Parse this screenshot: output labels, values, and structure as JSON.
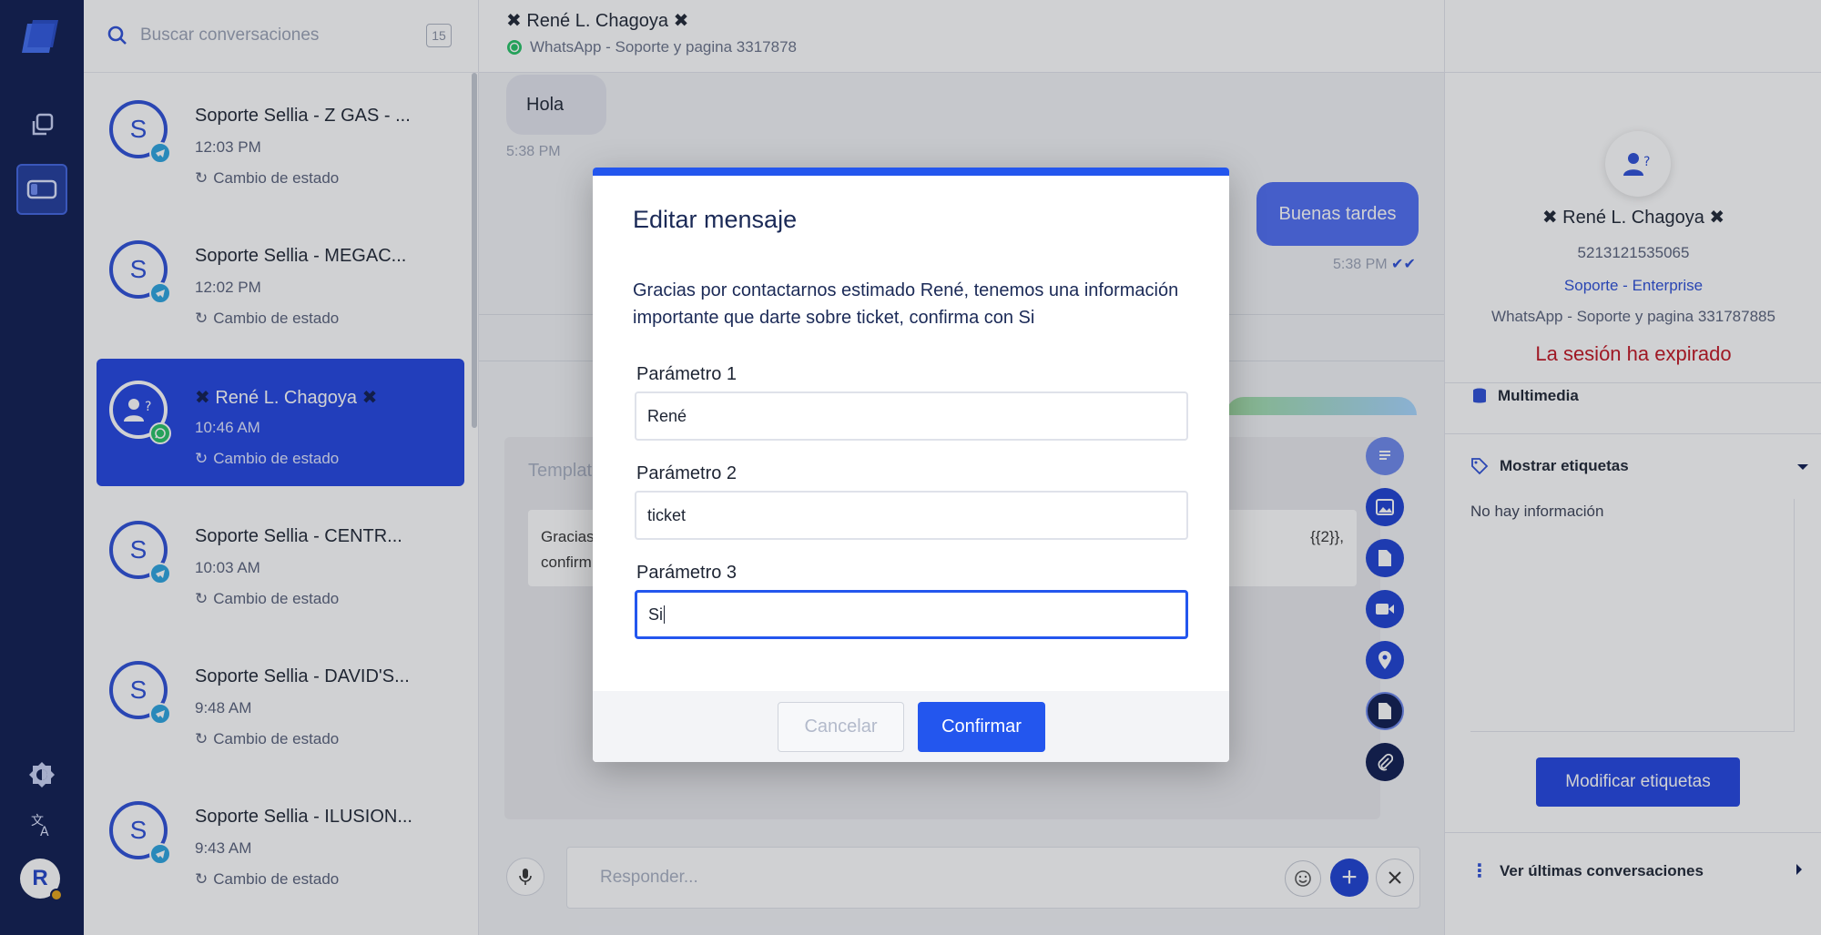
{
  "search": {
    "placeholder": "Buscar conversaciones",
    "count": "15"
  },
  "conversations": [
    {
      "title": "Soporte Sellia - Z GAS - ...",
      "time": "12:03 PM",
      "status": "Cambio de estado",
      "initial": "S",
      "channel": "telegram"
    },
    {
      "title": "Soporte Sellia - MEGAC...",
      "time": "12:02 PM",
      "status": "Cambio de estado",
      "initial": "S",
      "channel": "telegram"
    },
    {
      "title": "René L. Chagoya",
      "time": "10:46 AM",
      "status": "Cambio de estado",
      "initial": "",
      "channel": "whatsapp",
      "selected": true
    },
    {
      "title": "Soporte Sellia - CENTR...",
      "time": "10:03 AM",
      "status": "Cambio de estado",
      "initial": "S",
      "channel": "telegram"
    },
    {
      "title": "Soporte Sellia - DAVID'S...",
      "time": "9:48 AM",
      "status": "Cambio de estado",
      "initial": "S",
      "channel": "telegram"
    },
    {
      "title": "Soporte Sellia - ILUSION...",
      "time": "9:43 AM",
      "status": "Cambio de estado",
      "initial": "S",
      "channel": "telegram"
    }
  ],
  "rail": {
    "user_initial": "R"
  },
  "chat": {
    "contact_name": "René L. Chagoya",
    "channel": "WhatsApp - Soporte y pagina 3317878",
    "incoming": {
      "text": "Hola",
      "time": "5:38 PM"
    },
    "outgoing": {
      "text": "Buenas tardes",
      "time": "5:38 PM"
    },
    "template_label": "Templat",
    "template_text_left": "Gracias",
    "template_text_left2": "confirm",
    "template_text_right": "{{2}},",
    "reply_placeholder": "Responder..."
  },
  "contact": {
    "name": "René L. Chagoya",
    "phone": "5213121535065",
    "team": "Soporte - Enterprise",
    "channel": "WhatsApp - Soporte y pagina 331787885",
    "expired": "La sesión ha expirado",
    "multimedia": "Multimedia",
    "tags_toggle": "Mostrar etiquetas",
    "no_info": "No hay información",
    "modify_tags": "Modificar etiquetas",
    "last_conversations": "Ver últimas conversaciones"
  },
  "modal": {
    "title": "Editar mensaje",
    "description": "Gracias por contactarnos estimado René, tenemos una información importante que darte sobre ticket, confirma con Si",
    "params": [
      {
        "label": "Parámetro 1",
        "value": "René"
      },
      {
        "label": "Parámetro 2",
        "value": "ticket"
      },
      {
        "label": "Parámetro 3",
        "value": "Si"
      }
    ],
    "cancel": "Cancelar",
    "confirm": "Confirmar"
  },
  "colors": {
    "primary": "#2356ee",
    "rail": "#0c1a4f",
    "expired": "#c1121f",
    "whatsapp": "#25c265",
    "telegram": "#2aa3df"
  }
}
